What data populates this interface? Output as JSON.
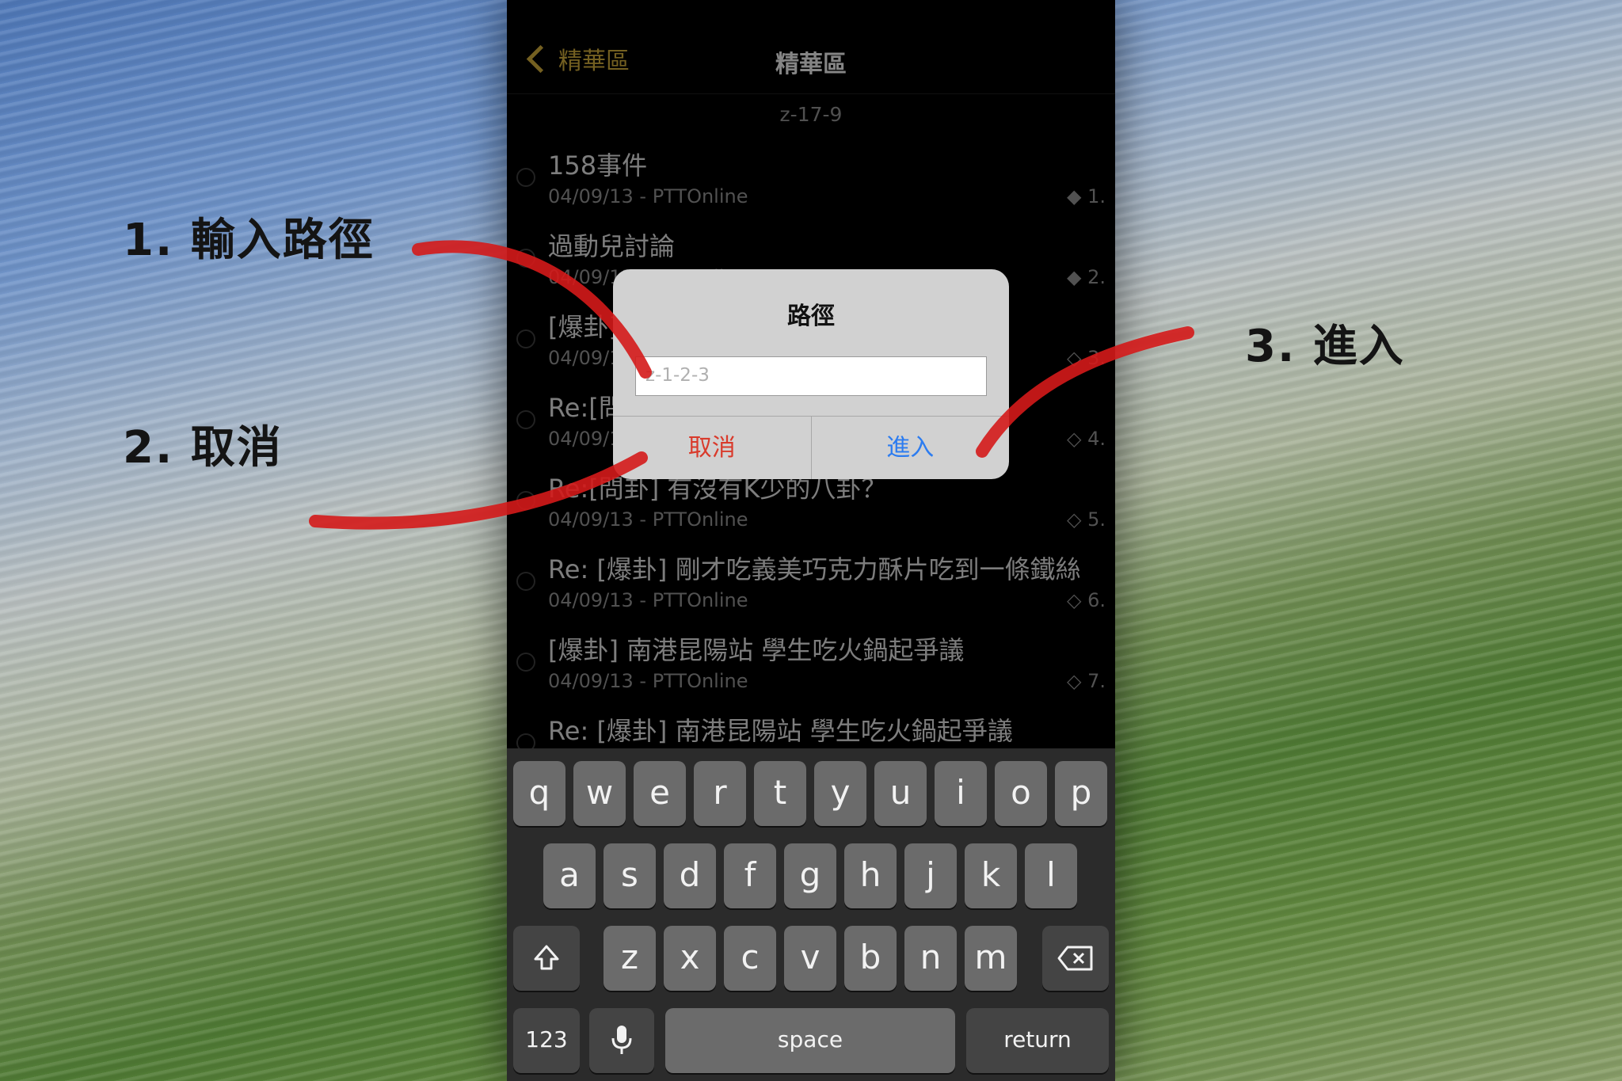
{
  "annotations": {
    "step1": "1. 輸入路徑",
    "step2": "2. 取消",
    "step3": "3. 進入"
  },
  "nav": {
    "back_label": "精華區",
    "title": "精華區"
  },
  "path_label": "z-17-9",
  "items": [
    {
      "title": "158事件",
      "meta": "04/09/13 - PTTOnline",
      "num": "◆ 1."
    },
    {
      "title": "過動兒討論",
      "meta": "04/09/13 - PTTOnline",
      "num": "◆ 2."
    },
    {
      "title": "[爆卦]",
      "meta": "04/09/13 - PTTOnline",
      "num": "◇ 3."
    },
    {
      "title": "Re:[問卦]",
      "meta": "04/09/13 - PTTOnline",
      "num": "◇ 4."
    },
    {
      "title": "Re:[問卦] 有沒有K少的八卦？",
      "meta": "04/09/13 - PTTOnline",
      "num": "◇ 5."
    },
    {
      "title": "Re: [爆卦] 剛才吃義美巧克力酥片吃到一條鐵絲",
      "meta": "04/09/13 - PTTOnline",
      "num": "◇ 6."
    },
    {
      "title": "[爆卦] 南港昆陽站 學生吃火鍋起爭議",
      "meta": "04/09/13 - PTTOnline",
      "num": "◇ 7."
    },
    {
      "title": "Re: [爆卦] 南港昆陽站 學生吃火鍋起爭議",
      "meta": "",
      "num": ""
    }
  ],
  "dialog": {
    "title": "路徑",
    "input_placeholder": "z-1-2-3",
    "cancel_label": "取消",
    "enter_label": "進入"
  },
  "keyboard": {
    "row1": [
      "q",
      "w",
      "e",
      "r",
      "t",
      "y",
      "u",
      "i",
      "o",
      "p"
    ],
    "row2": [
      "a",
      "s",
      "d",
      "f",
      "g",
      "h",
      "j",
      "k",
      "l"
    ],
    "row3": [
      "z",
      "x",
      "c",
      "v",
      "b",
      "n",
      "m"
    ],
    "shift_icon": "shift-icon",
    "delete_icon": "delete-icon",
    "mic_icon": "microphone-icon",
    "numbers_label": "123",
    "space_label": "space",
    "return_label": "return"
  },
  "colors": {
    "accent_gold": "#c9a53a",
    "cancel_red": "#d93a2b",
    "enter_blue": "#2c7cf0",
    "arrow_red": "#d41a1a"
  }
}
